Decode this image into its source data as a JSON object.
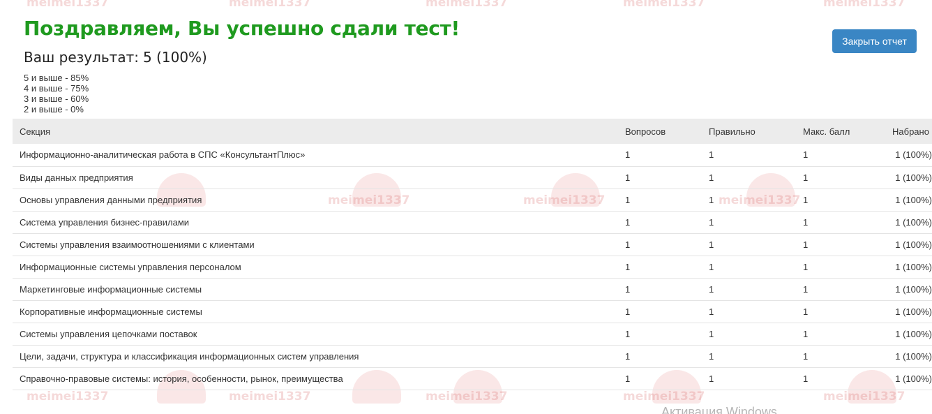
{
  "header": {
    "congrats": "Поздравляем, Вы успешно сдали тест!",
    "score_label": "Ваш результат:",
    "score_value": "5 (100%)",
    "close_button": "Закрыть отчет"
  },
  "grades": [
    "5 и выше - 85%",
    "4 и выше - 75%",
    "3 и выше - 60%",
    "2 и выше - 0%"
  ],
  "table": {
    "headers": {
      "section": "Секция",
      "questions": "Вопросов",
      "correct": "Правильно",
      "max": "Макс. балл",
      "scored": "Набрано"
    },
    "rows": [
      {
        "section": "Информационно-аналитическая работа в СПС «КонсультантПлюс»",
        "questions": "1",
        "correct": "1",
        "max": "1",
        "scored": "1 (100%)"
      },
      {
        "section": "Виды данных предприятия",
        "questions": "1",
        "correct": "1",
        "max": "1",
        "scored": "1 (100%)"
      },
      {
        "section": "Основы управления данными предприятия",
        "questions": "1",
        "correct": "1",
        "max": "1",
        "scored": "1 (100%)"
      },
      {
        "section": "Система управления бизнес-правилами",
        "questions": "1",
        "correct": "1",
        "max": "1",
        "scored": "1 (100%)"
      },
      {
        "section": "Системы управления взаимоотношениями с клиентами",
        "questions": "1",
        "correct": "1",
        "max": "1",
        "scored": "1 (100%)"
      },
      {
        "section": "Информационные системы управления персоналом",
        "questions": "1",
        "correct": "1",
        "max": "1",
        "scored": "1 (100%)"
      },
      {
        "section": "Маркетинговые информационные системы",
        "questions": "1",
        "correct": "1",
        "max": "1",
        "scored": "1 (100%)"
      },
      {
        "section": "Корпоративные информационные системы",
        "questions": "1",
        "correct": "1",
        "max": "1",
        "scored": "1 (100%)"
      },
      {
        "section": "Системы управления цепочками поставок",
        "questions": "1",
        "correct": "1",
        "max": "1",
        "scored": "1 (100%)"
      },
      {
        "section": "Цели, задачи, структура и классификация информационных систем управления",
        "questions": "1",
        "correct": "1",
        "max": "1",
        "scored": "1 (100%)"
      },
      {
        "section": "Справочно-правовые системы: история, особенности, рынок, преимущества",
        "questions": "1",
        "correct": "1",
        "max": "1",
        "scored": "1 (100%)"
      }
    ]
  },
  "watermark": {
    "text": "meimei1337"
  },
  "os_overlay": {
    "text": "Активация Windows"
  },
  "colors": {
    "congrats": "#1f9a1f",
    "button": "#3a86c4",
    "header_row": "#ececec"
  }
}
